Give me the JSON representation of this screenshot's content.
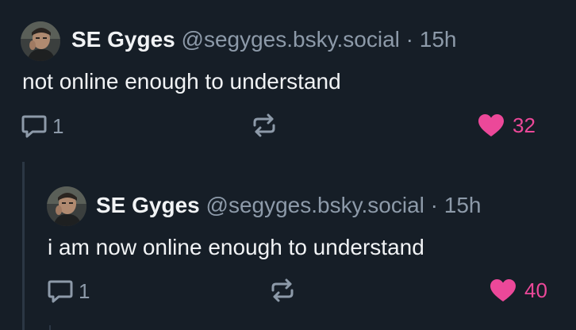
{
  "posts": [
    {
      "author_name": "SE Gyges",
      "author_handle": "@segyges.bsky.social",
      "separator": "·",
      "time": "15h",
      "text": "not online enough to understand",
      "reply_count": "1",
      "like_count": "32",
      "liked": true
    },
    {
      "author_name": "SE Gyges",
      "author_handle": "@segyges.bsky.social",
      "separator": "·",
      "time": "15h",
      "text": "i am now online enough to understand",
      "reply_count": "1",
      "like_count": "40",
      "liked": true
    }
  ],
  "colors": {
    "background": "#161e27",
    "text_primary": "#f1f3f5",
    "text_secondary": "#8d9aa9",
    "like_accent": "#ec4899",
    "icon": "#8d9aa9",
    "thread_line": "#2b3744"
  },
  "icons": {
    "reply": "speech-bubble-icon",
    "repost": "repost-arrows-icon",
    "like": "heart-icon"
  }
}
